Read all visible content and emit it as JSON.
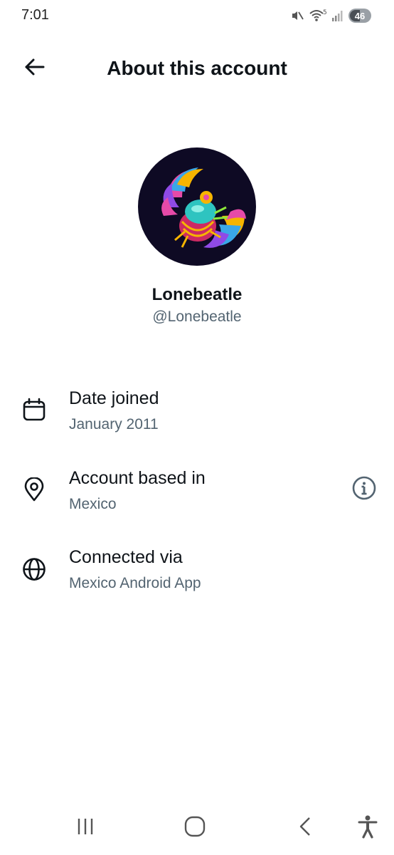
{
  "status_bar": {
    "time": "7:01",
    "battery": "46",
    "icons": [
      "mute-icon",
      "wifi-icon",
      "signal-icon",
      "battery-icon"
    ]
  },
  "header": {
    "title": "About this account",
    "back_icon": "back-arrow-icon"
  },
  "profile": {
    "display_name": "Lonebeatle",
    "handle": "@Lonebeatle"
  },
  "info_rows": [
    {
      "icon": "calendar-icon",
      "label": "Date joined",
      "value": "January 2011"
    },
    {
      "icon": "location-pin-icon",
      "label": "Account based in",
      "value": "Mexico",
      "action_icon": "info-icon"
    },
    {
      "icon": "globe-icon",
      "label": "Connected via",
      "value": "Mexico Android App"
    }
  ],
  "nav_bar": {
    "items": [
      "recent-apps-icon",
      "home-icon",
      "back-icon",
      "accessibility-icon"
    ]
  },
  "colors": {
    "text_primary": "#0f1419",
    "text_secondary": "#536471",
    "avatar_background": "#0e0a24"
  }
}
